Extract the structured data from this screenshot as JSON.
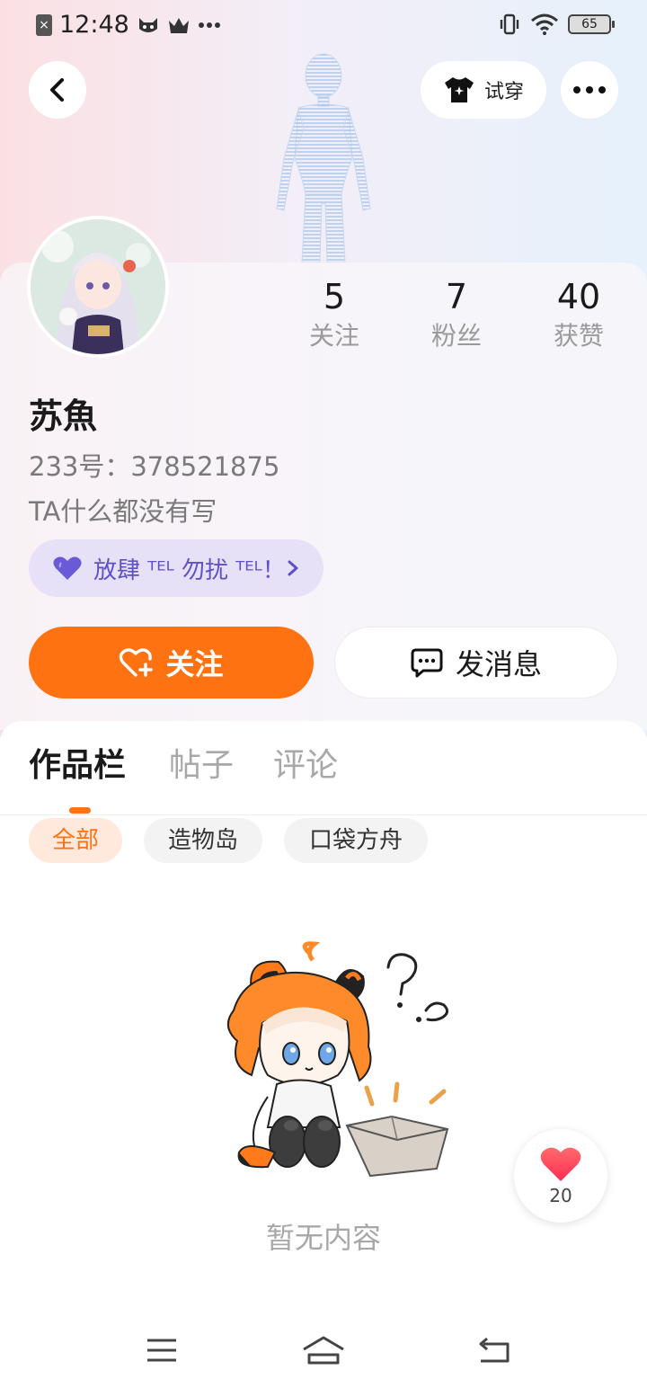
{
  "status_bar": {
    "time": "12:48",
    "battery": "65",
    "icons": [
      "sim-off-icon",
      "cat-icon",
      "crown-icon",
      "more-dots-icon",
      "vibrate-icon",
      "wifi-icon",
      "battery-icon"
    ]
  },
  "header": {
    "tryon_label": "试穿"
  },
  "profile": {
    "name": "苏魚",
    "id_line": "233号：378521875",
    "bio": "TA什么都没有写",
    "tag": "放肆 ᵀᴱᴸ 勿扰 ᵀᴱᴸ！",
    "stats": [
      {
        "value": "5",
        "label": "关注"
      },
      {
        "value": "7",
        "label": "粉丝"
      },
      {
        "value": "40",
        "label": "获赞"
      }
    ]
  },
  "actions": {
    "follow_label": "关注",
    "message_label": "发消息"
  },
  "tabs": [
    "作品栏",
    "帖子",
    "评论"
  ],
  "filters": [
    "全部",
    "造物岛",
    "口袋方舟"
  ],
  "empty_state": {
    "text": "暂无内容"
  },
  "floating_like": {
    "count": "20"
  },
  "colors": {
    "accent": "#ff7212",
    "tag_text": "#6050c8",
    "tag_bg": "#e6e1f7"
  }
}
